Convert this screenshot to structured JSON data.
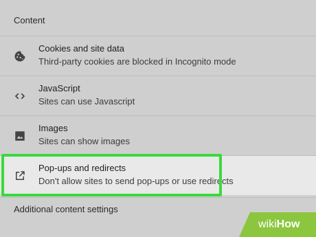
{
  "section": {
    "title": "Content"
  },
  "items": [
    {
      "title": "Cookies and site data",
      "subtitle": "Third-party cookies are blocked in Incognito mode",
      "icon": "cookie-icon"
    },
    {
      "title": "JavaScript",
      "subtitle": "Sites can use Javascript",
      "icon": "code-brackets-icon"
    },
    {
      "title": "Images",
      "subtitle": "Sites can show images",
      "icon": "image-icon"
    },
    {
      "title": "Pop-ups and redirects",
      "subtitle": "Don't allow sites to send pop-ups or use redirects",
      "icon": "open-in-new-icon"
    }
  ],
  "additional": {
    "label": "Additional content settings"
  },
  "highlight": {
    "color": "#39d93d"
  },
  "watermark": {
    "wiki": "wiki",
    "how": "How"
  }
}
